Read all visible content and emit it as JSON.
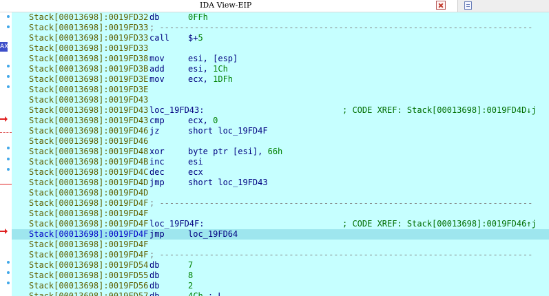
{
  "window": {
    "title": "IDA View-EIP"
  },
  "gutter": {
    "register_badge": "AX"
  },
  "lines": [
    {
      "addr": "Stack[00013698]:0019FD32",
      "mn": "db",
      "ops": [
        {
          "t": "0FFh",
          "k": "num"
        }
      ]
    },
    {
      "addr": "Stack[00013698]:0019FD33",
      "sep": "; ---------------------------------------------------------------------------"
    },
    {
      "addr": "Stack[00013698]:0019FD33",
      "mn": "call",
      "ops": [
        {
          "t": "$+",
          "k": "plain"
        },
        {
          "t": "5",
          "k": "num"
        }
      ]
    },
    {
      "addr": "Stack[00013698]:0019FD33"
    },
    {
      "addr": "Stack[00013698]:0019FD38",
      "mn": "mov",
      "ops": [
        {
          "t": "esi, [esp]",
          "k": "plain"
        }
      ]
    },
    {
      "addr": "Stack[00013698]:0019FD3B",
      "mn": "add",
      "ops": [
        {
          "t": "esi, ",
          "k": "plain"
        },
        {
          "t": "1Ch",
          "k": "num"
        }
      ]
    },
    {
      "addr": "Stack[00013698]:0019FD3E",
      "mn": "mov",
      "ops": [
        {
          "t": "ecx, ",
          "k": "plain"
        },
        {
          "t": "1DFh",
          "k": "num"
        }
      ]
    },
    {
      "addr": "Stack[00013698]:0019FD3E"
    },
    {
      "addr": "Stack[00013698]:0019FD43"
    },
    {
      "addr": "Stack[00013698]:0019FD43",
      "label": "loc_19FD43:",
      "comment": "; CODE XREF: Stack[00013698]:0019FD4D↓j"
    },
    {
      "addr": "Stack[00013698]:0019FD43",
      "mn": "cmp",
      "ops": [
        {
          "t": "ecx, ",
          "k": "plain"
        },
        {
          "t": "0",
          "k": "num"
        }
      ]
    },
    {
      "addr": "Stack[00013698]:0019FD46",
      "mn": "jz",
      "ops": [
        {
          "t": "short loc_19FD4F",
          "k": "plain"
        }
      ]
    },
    {
      "addr": "Stack[00013698]:0019FD46"
    },
    {
      "addr": "Stack[00013698]:0019FD48",
      "mn": "xor",
      "ops": [
        {
          "t": "byte ptr [esi], ",
          "k": "plain"
        },
        {
          "t": "66h",
          "k": "num"
        }
      ]
    },
    {
      "addr": "Stack[00013698]:0019FD4B",
      "mn": "inc",
      "ops": [
        {
          "t": "esi",
          "k": "plain"
        }
      ]
    },
    {
      "addr": "Stack[00013698]:0019FD4C",
      "mn": "dec",
      "ops": [
        {
          "t": "ecx",
          "k": "plain"
        }
      ]
    },
    {
      "addr": "Stack[00013698]:0019FD4D",
      "mn": "jmp",
      "ops": [
        {
          "t": "short loc_19FD43",
          "k": "plain"
        }
      ]
    },
    {
      "addr": "Stack[00013698]:0019FD4D"
    },
    {
      "addr": "Stack[00013698]:0019FD4F",
      "sep": "; ---------------------------------------------------------------------------"
    },
    {
      "addr": "Stack[00013698]:0019FD4F"
    },
    {
      "addr": "Stack[00013698]:0019FD4F",
      "label": "loc_19FD4F:",
      "comment": "; CODE XREF: Stack[00013698]:0019FD46↑j"
    },
    {
      "addr": "Stack[00013698]:0019FD4F",
      "mn": "jmp",
      "ops": [
        {
          "t": "loc_19FD64",
          "k": "plain"
        }
      ],
      "current": true
    },
    {
      "addr": "Stack[00013698]:0019FD4F"
    },
    {
      "addr": "Stack[00013698]:0019FD4F",
      "sep": "; ---------------------------------------------------------------------------"
    },
    {
      "addr": "Stack[00013698]:0019FD54",
      "mn": "db",
      "ops": [
        {
          "t": "7",
          "k": "num"
        }
      ]
    },
    {
      "addr": "Stack[00013698]:0019FD55",
      "mn": "db",
      "ops": [
        {
          "t": "8",
          "k": "num"
        }
      ]
    },
    {
      "addr": "Stack[00013698]:0019FD56",
      "mn": "db",
      "ops": [
        {
          "t": "2",
          "k": "num"
        }
      ]
    },
    {
      "addr": "Stack[00013698]:0019FD57",
      "mn": "db",
      "ops": [
        {
          "t": "4Ch",
          "k": "num"
        },
        {
          "t": " ; L",
          "k": "plain"
        }
      ]
    }
  ]
}
